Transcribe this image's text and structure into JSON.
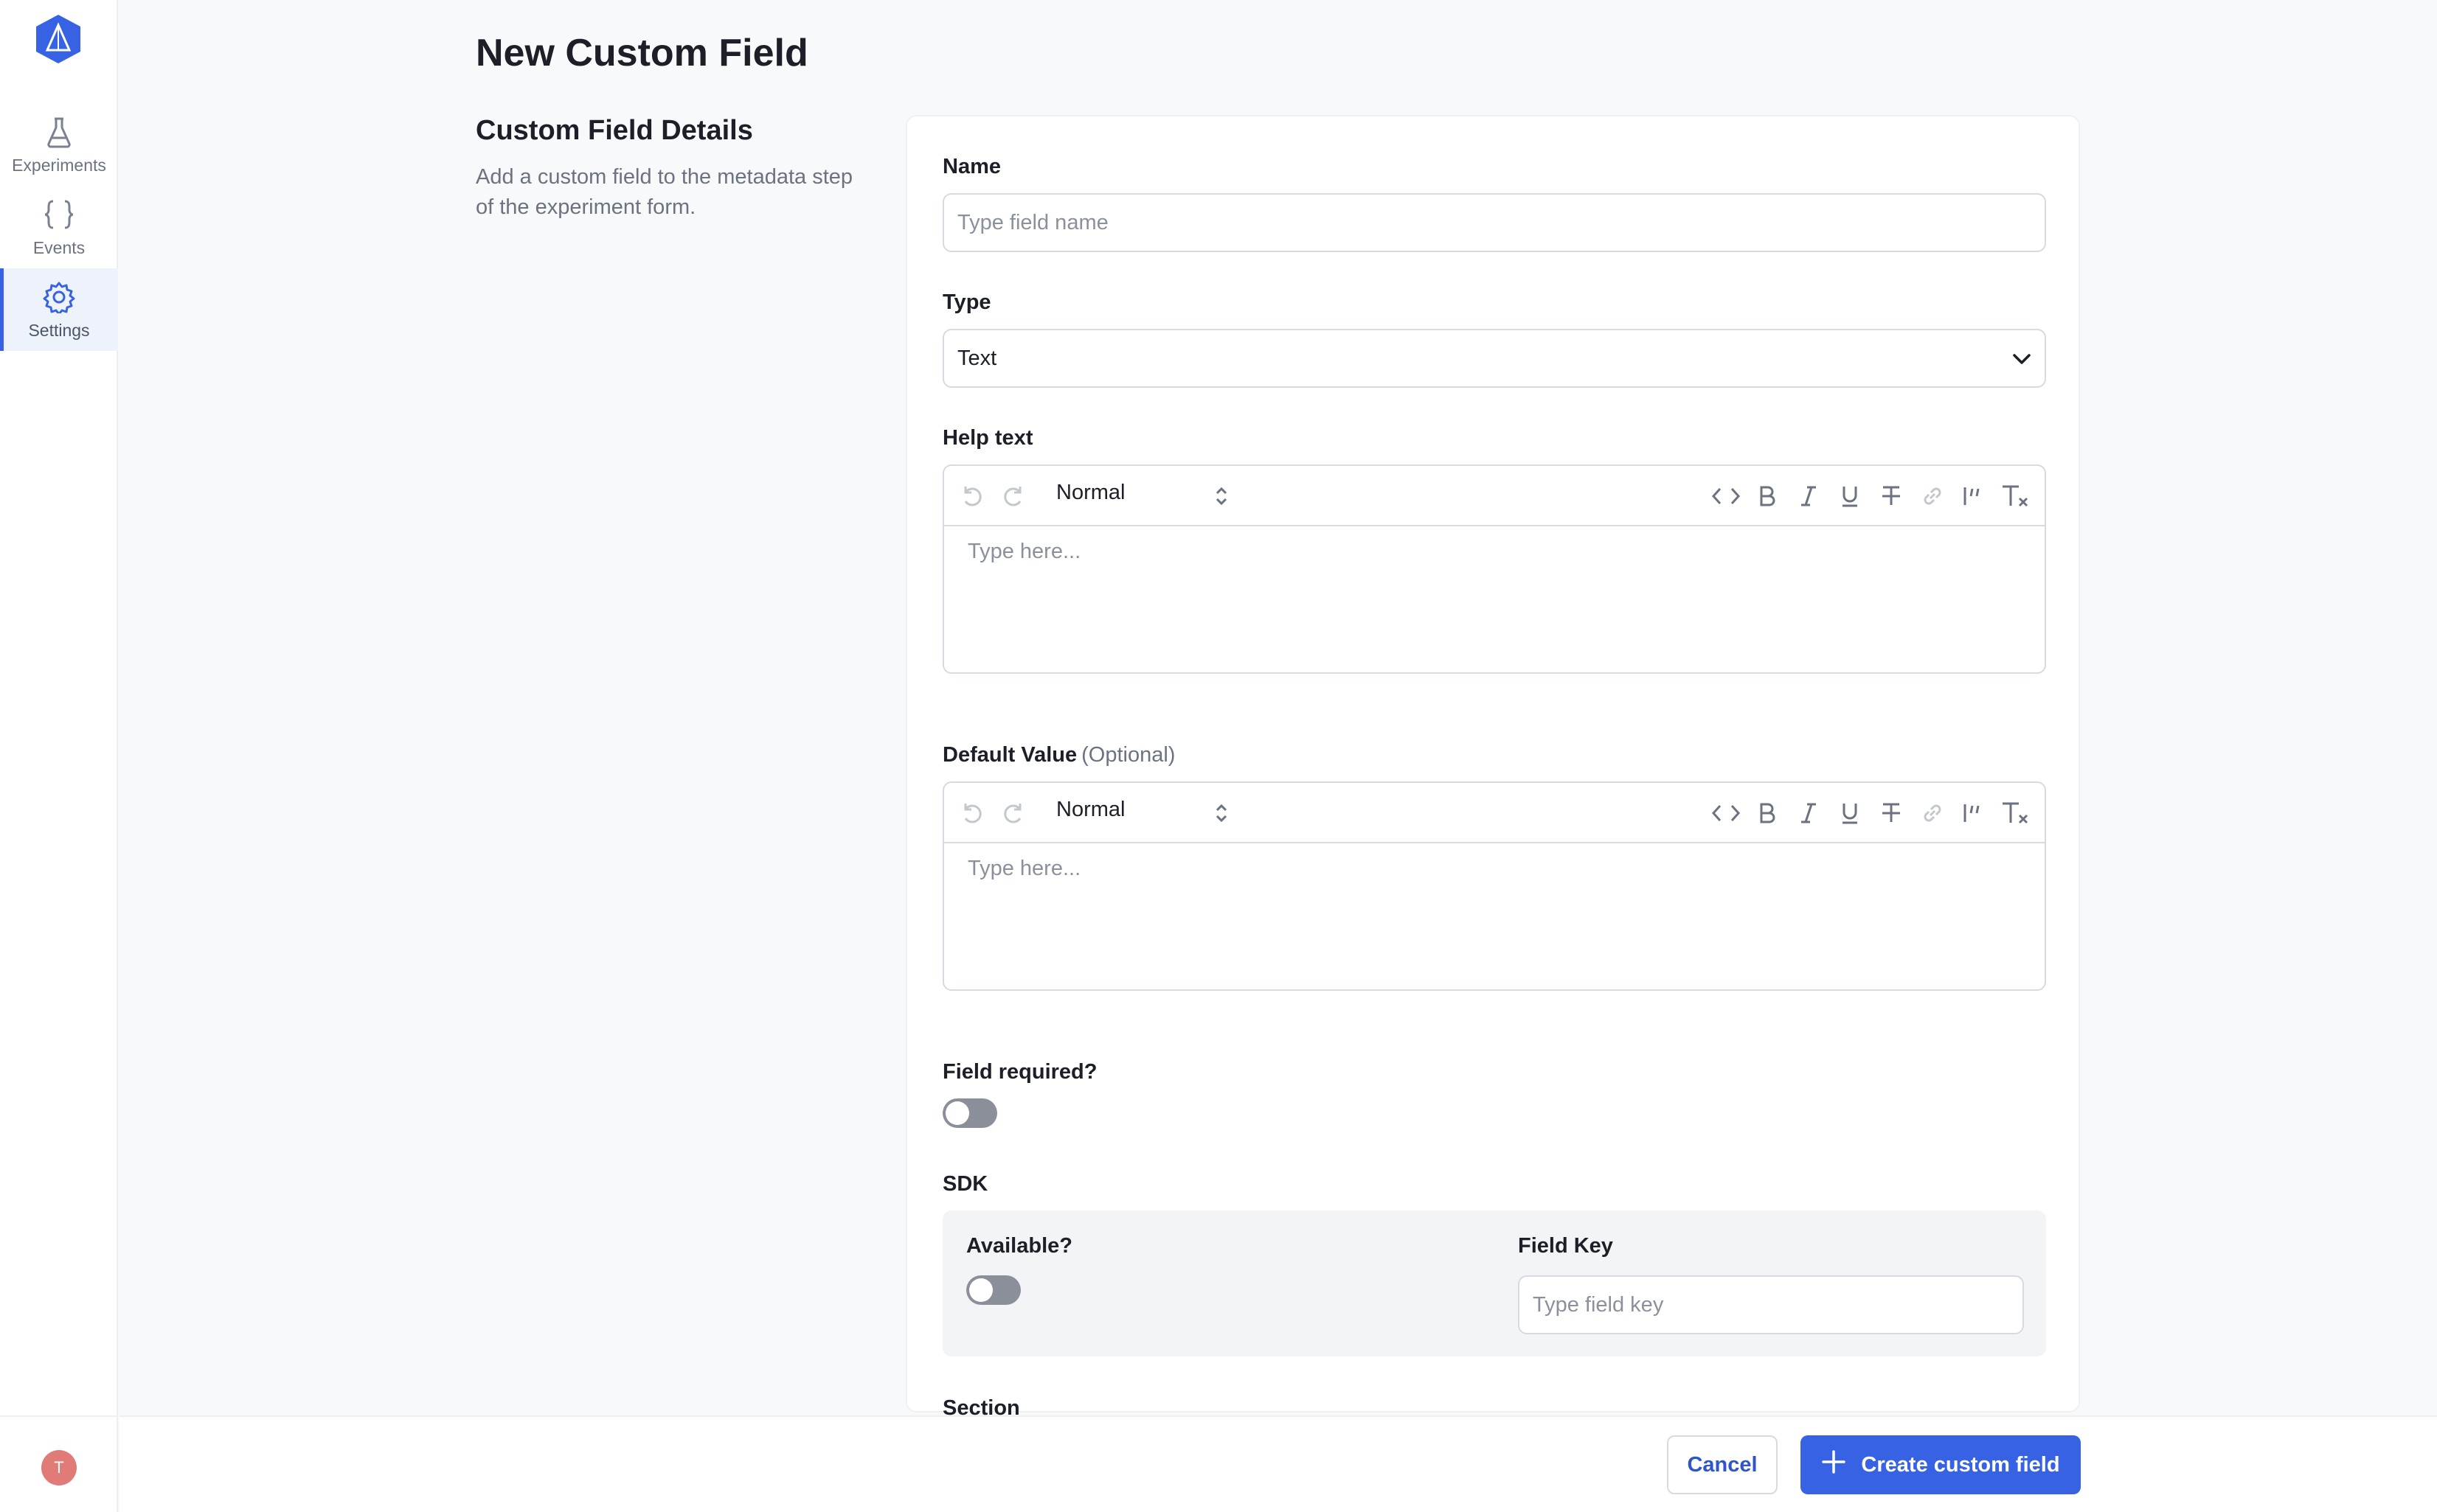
{
  "sidebar": {
    "logo_icon": "hexagon-flask-logo-icon",
    "items": [
      {
        "label": "Experiments",
        "icon": "flask-icon",
        "active": false
      },
      {
        "label": "Events",
        "icon": "braces-icon",
        "active": false
      },
      {
        "label": "Settings",
        "icon": "gear-icon",
        "active": true
      }
    ],
    "user_initial": "T"
  },
  "page": {
    "title": "New Custom Field",
    "section_title": "Custom Field Details",
    "section_description": "Add a custom field to the metadata step of the experiment form."
  },
  "form": {
    "name": {
      "label": "Name",
      "placeholder": "Type field name",
      "value": ""
    },
    "type": {
      "label": "Type",
      "value": "Text"
    },
    "help_text": {
      "label": "Help text",
      "format": "Normal",
      "placeholder": "Type here..."
    },
    "default_value": {
      "label": "Default Value",
      "optional": "(Optional)",
      "format": "Normal",
      "placeholder": "Type here..."
    },
    "field_required": {
      "label": "Field required?",
      "on": false
    },
    "sdk": {
      "label": "SDK",
      "available": {
        "label": "Available?",
        "on": false
      },
      "field_key": {
        "label": "Field Key",
        "placeholder": "Type field key",
        "value": ""
      }
    },
    "section": {
      "label": "Section"
    }
  },
  "toolbar_icons": [
    "undo-icon",
    "redo-icon",
    "code-icon",
    "bold-icon",
    "italic-icon",
    "underline-icon",
    "strikethrough-icon",
    "link-icon",
    "quote-icon",
    "clear-format-icon"
  ],
  "footer": {
    "cancel_label": "Cancel",
    "create_label": "Create custom field"
  },
  "colors": {
    "accent": "#3662e3",
    "avatar": "#e07b78",
    "toggle_off": "#8a8f9a"
  }
}
